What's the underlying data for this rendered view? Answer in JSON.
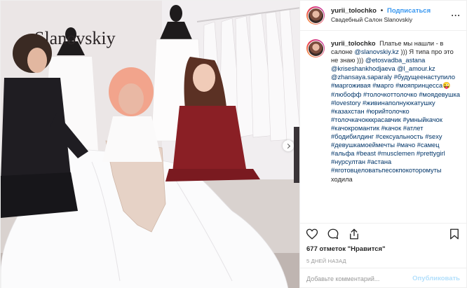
{
  "photo": {
    "alt": "Salon photo",
    "brand_sign": "Slanovskiy",
    "carousel_next_icon": "chevron-right-icon"
  },
  "header": {
    "username": "yurii_tolochko",
    "separator": "•",
    "follow_label": "Подписаться",
    "location": "Свадебный Салон Slanovskiy",
    "more_icon": "more-horizontal-icon"
  },
  "caption": {
    "username": "yurii_tolochko",
    "text": "Платье мы нашли - в салоне",
    "mention1": "@slanovskiy.kz",
    "text2": "))) Я типа про это не знаю ))) ",
    "tags": [
      "@etosvadba_astana",
      "@kriseshankhodjaeva",
      "@l_amour.kz",
      "@zhansaya.saparaly",
      "#будущеенаступило",
      "#маргоживая",
      "#марго",
      "#мояпринцесса😜",
      "#любофф",
      "#толочкоттолочко",
      "#моядевушка",
      "#lovestory",
      "#живинаполнуюкатушку",
      "#казахстан",
      "#юрийтолочко",
      "#толочкачокккрасавчик",
      "#умныйкачок",
      "#качокромантик",
      "#качок",
      "#атлет",
      "#бодибилдинг",
      "#сексуальность",
      "#sexy",
      "#девушкамоеймечты",
      "#мачо",
      "#самец",
      "#альфа",
      "#beast",
      "#musclemen",
      "#prettygirl",
      "#нурсултан",
      "#астана",
      "#яготовцеловатьпесокпокоторомуты",
      "ходила"
    ]
  },
  "actions": {
    "like_icon": "heart-icon",
    "comment_icon": "comment-icon",
    "share_icon": "share-icon",
    "save_icon": "bookmark-icon"
  },
  "likes_text": "677 отметок \"Нравится\"",
  "time_text": "5 ДНЕЙ НАЗАД",
  "comment": {
    "placeholder": "Добавьте комментарий...",
    "post_label": "Опубликовать"
  },
  "colors": {
    "link": "#003569",
    "follow": "#3897f0",
    "post_disabled": "#b2dffc"
  }
}
